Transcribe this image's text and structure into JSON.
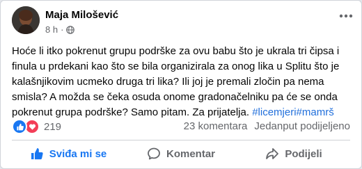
{
  "post": {
    "author": "Maja Milošević",
    "time": "8 h",
    "text": "Hoće li itko pokrenut grupu podrške za ovu babu što je ukrala tri čipsa i finula u prdekani kao što se bila organizirala za onog lika u Splitu što je kalašnjikovim ucmeko druga tri lika? Ili joj je premali zločin pa nema smisla? A možda se čeka osuda onome gradonačelniku pa će se onda pokrenut grupa podrške? Samo pitam. Za prijatelja.",
    "hashtags": [
      "#licemjeri",
      "#mamrš"
    ]
  },
  "stats": {
    "reactions_count": "219",
    "comments": "23 komentara",
    "shares": "Jedanput podijeljeno"
  },
  "actions": {
    "like_label": "Sviđa mi se",
    "comment_label": "Komentar",
    "share_label": "Podijeli"
  },
  "icons": {
    "like": "thumbs-up-icon",
    "love": "heart-icon",
    "privacy": "globe-icon",
    "more": "more-options-icon",
    "comment": "comment-icon",
    "share": "share-icon"
  },
  "colors": {
    "accent": "#1877f2",
    "love": "#f33e58",
    "hashtag": "#216fdb",
    "muted": "#65676b"
  }
}
